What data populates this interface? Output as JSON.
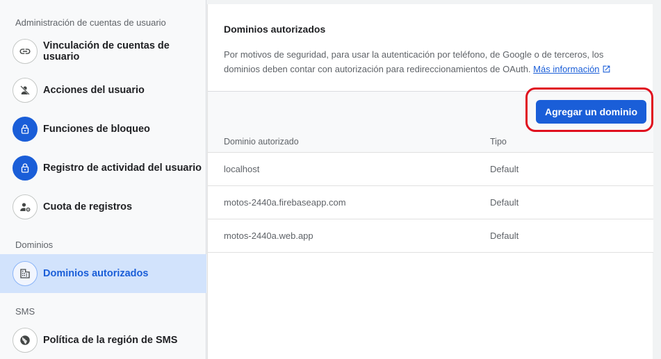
{
  "sidebar": {
    "section_user_admin": "Administración de cuentas de usuario",
    "section_domains": "Dominios",
    "section_sms": "SMS",
    "items": [
      {
        "label": "Vinculación de cuentas de usuario",
        "icon": "link-icon"
      },
      {
        "label": "Acciones del usuario",
        "icon": "user-off-icon"
      },
      {
        "label": "Funciones de bloqueo",
        "icon": "lock-icon"
      },
      {
        "label": "Registro de actividad del usuario",
        "icon": "lock-icon"
      },
      {
        "label": "Cuota de registros",
        "icon": "user-settings-icon"
      },
      {
        "label": "Dominios autorizados",
        "icon": "domain-icon",
        "active": true
      },
      {
        "label": "Política de la región de SMS",
        "icon": "globe-icon"
      }
    ]
  },
  "main": {
    "title": "Dominios autorizados",
    "description": "Por motivos de seguridad, para usar la autenticación por teléfono, de Google o de terceros, los dominios deben contar con autorización para redireccionamientos de OAuth.",
    "learn_more": "Más información",
    "add_button": "Agregar un dominio",
    "table": {
      "headers": [
        "Dominio autorizado",
        "Tipo"
      ],
      "rows": [
        [
          "localhost",
          "Default"
        ],
        [
          "motos-2440a.firebaseapp.com",
          "Default"
        ],
        [
          "motos-2440a.web.app",
          "Default"
        ]
      ]
    }
  },
  "colors": {
    "accent": "#1a5ed8",
    "highlight": "#e0101e",
    "active_bg": "#d2e3fc"
  }
}
